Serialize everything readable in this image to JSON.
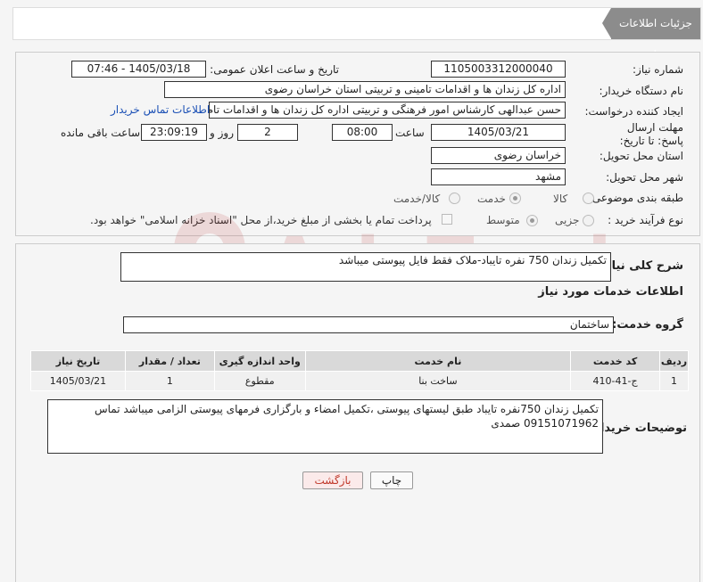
{
  "header": {
    "title": "جزئیات اطلاعات نیاز"
  },
  "form": {
    "need_number_label": "شماره نیاز:",
    "need_number": "1105003312000040",
    "announce_label": "تاریخ و ساعت اعلان عمومی:",
    "announce_value": "1405/03/18 - 07:46",
    "buyer_org_label": "نام دستگاه خریدار:",
    "buyer_org": "اداره کل زندان ها و اقدامات تامینی و تربیتی استان خراسان رضوی",
    "requester_label": "ایجاد کننده درخواست:",
    "requester": "حسن عبدالهی کارشناس امور فرهنگی و تربیتی اداره کل زندان ها و اقدامات تام",
    "contact_link": "اطلاعات تماس خریدار",
    "deadline_label": "مهلت ارسال پاسخ: تا تاریخ:",
    "deadline_date": "1405/03/21",
    "time_label": "ساعت",
    "deadline_time": "08:00",
    "days_value": "2",
    "days_label": "روز و",
    "remaining_time": "23:09:19",
    "remaining_label": "ساعت باقی مانده",
    "province_label": "استان محل تحویل:",
    "province": "خراسان رضوی",
    "city_label": "شهر محل تحویل:",
    "city": "مشهد",
    "category_label": "طبقه بندی موضوعی:",
    "category_options": [
      "کالا",
      "خدمت",
      "کالا/خدمت"
    ],
    "process_label": "نوع فرآیند خرید :",
    "process_options": [
      "جزیی",
      "متوسط"
    ],
    "payment_note": "پرداخت تمام یا بخشی از مبلغ خرید،از محل \"اسناد خزانه اسلامی\" خواهد بود."
  },
  "summary": {
    "label": "شرح کلی نیاز:",
    "text": "تکمیل زندان 750 نفره تایباد-ملاک فقط فایل پیوستی میباشد"
  },
  "services": {
    "section_title": "اطلاعات خدمات مورد نیاز",
    "group_label": "گروه خدمت:",
    "group_value": "ساختمان",
    "columns": [
      "ردیف",
      "کد خدمت",
      "نام خدمت",
      "واحد اندازه گیری",
      "تعداد / مقدار",
      "تاریخ نیاز"
    ],
    "rows": [
      [
        "1",
        "ج-41-410",
        "ساخت بنا",
        "مقطوع",
        "1",
        "1405/03/21"
      ]
    ]
  },
  "buyer_notes": {
    "label": "توضیحات خریدار:",
    "text": "تکمیل زندان 750نفره تایباد طبق لیستهای پیوستی ،تکمیل امضاء و بارگزاری فرمهای پیوستی الزامی میباشد  تماس 09151071962 صمدی"
  },
  "buttons": {
    "print": "چاپ",
    "back": "بازگشت"
  },
  "watermark": {
    "text": "AriaTender.neT"
  },
  "colors": {
    "header_bg": "#8c8c8c",
    "link": "#1a4fb5",
    "back_text": "#c0392b"
  }
}
